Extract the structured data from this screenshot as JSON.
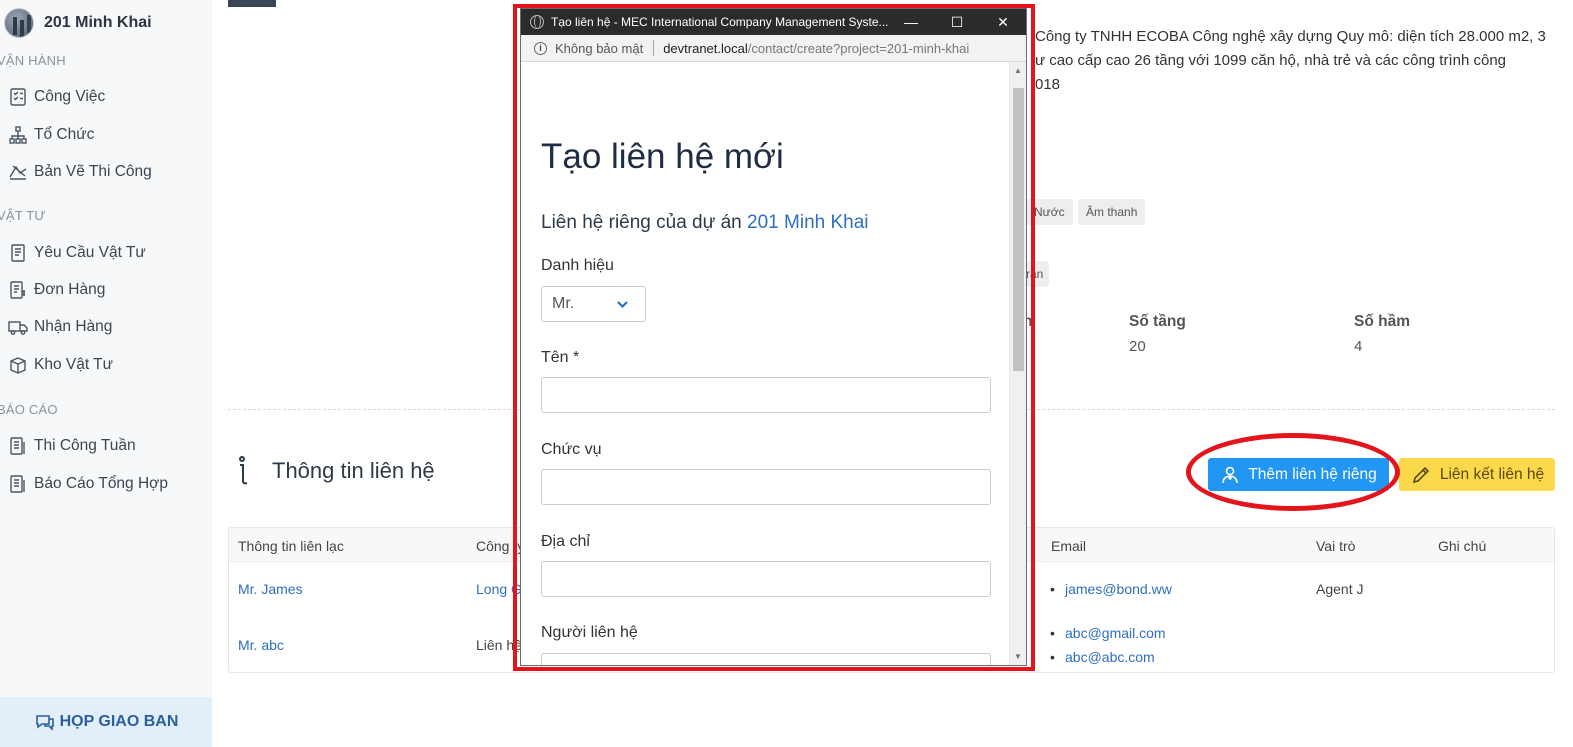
{
  "sidebar": {
    "project_name": "201 Minh Khai",
    "sections": [
      {
        "title": "VẬN HÀNH",
        "items": [
          "Công Việc",
          "Tổ Chức",
          "Bản Vẽ Thi Công"
        ]
      },
      {
        "title": "VẬT TƯ",
        "items": [
          "Yêu Cầu Vật Tư",
          "Đơn Hàng",
          "Nhận Hàng",
          "Kho Vật Tư"
        ]
      },
      {
        "title": "BÁO CÁO",
        "items": [
          "Thi Công Tuần",
          "Báo Cáo Tổng Hợp"
        ]
      }
    ],
    "meeting_label": "HỌP GIAO BAN"
  },
  "main": {
    "description_lines": [
      "Công ty TNHH ECOBA Công nghệ xây dựng Quy mô: diện tích 28.000 m2, 3",
      "ư cao cấp cao 26 tầng với 1099 căn hộ, nhà trẻ và các công trình công",
      "018"
    ],
    "tags_row1": [
      "Nước",
      "Âm thanh"
    ],
    "tag_row2_fragment": "ran",
    "info_label_fragment": "n",
    "stats": [
      {
        "label": "Số tầng",
        "value": "20"
      },
      {
        "label": "Số hầm",
        "value": "4"
      }
    ],
    "contact_section_title": "Thông tin liên hệ",
    "btn_add_private": "Thêm liên hệ riêng",
    "btn_link_contact": "Liên kết liên hệ",
    "table": {
      "headers": [
        "Thông tin liên lạc",
        "Công ty",
        "Email",
        "Vai trò",
        "Ghi chú"
      ],
      "rows": [
        {
          "name": "Mr. James",
          "company": "Long Gi",
          "emails": [
            "james@bond.ww"
          ],
          "role": "Agent J",
          "note": ""
        },
        {
          "name": "Mr. abc",
          "company": "Liên hệ",
          "emails": [
            "abc@gmail.com",
            "abc@abc.com"
          ],
          "role": "",
          "note": ""
        }
      ]
    }
  },
  "popup": {
    "window_title": "Tạo liên hệ - MEC International Company Management Syste...",
    "security_label": "Không bảo mật",
    "url_host": "devtranet.local",
    "url_path": "/contact/create?project=201-minh-khai",
    "heading": "Tạo liên hệ mới",
    "subtitle_prefix": "Liên hệ riêng của dự án",
    "subtitle_project": "201 Minh Khai",
    "fields": {
      "title_label": "Danh hiệu",
      "title_value": "Mr.",
      "name_label": "Tên *",
      "position_label": "Chức vụ",
      "address_label": "Địa chỉ",
      "contact_person_label": "Người liên hệ"
    }
  },
  "colors": {
    "accent_blue": "#2196f3",
    "accent_yellow": "#fcd94a",
    "highlight_red": "#e3141b",
    "link_blue": "#2f6fc0"
  }
}
